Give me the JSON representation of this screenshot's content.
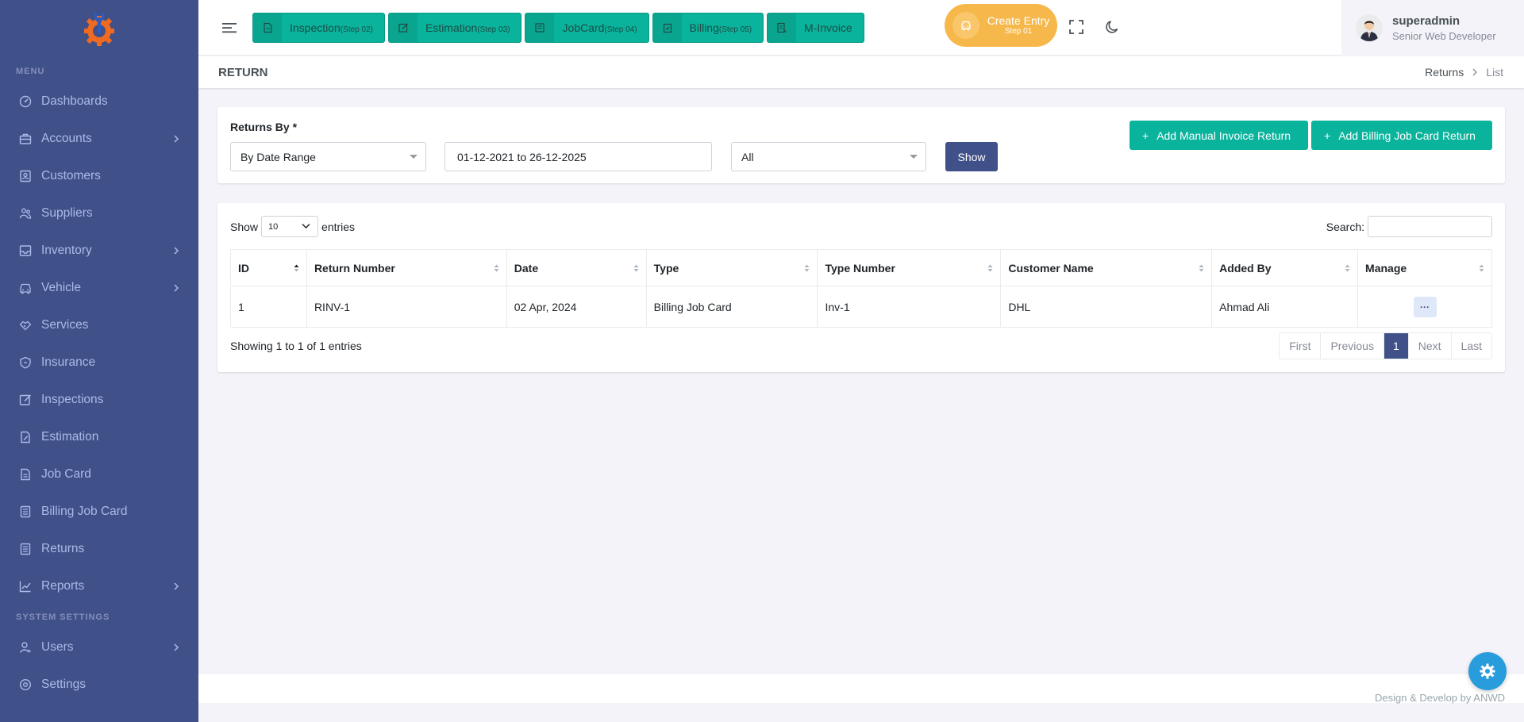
{
  "sidebar": {
    "menu_title": "MENU",
    "system_title": "SYSTEM SETTINGS",
    "items": [
      {
        "label": "Dashboards",
        "icon": "dashboard-icon",
        "has_children": false
      },
      {
        "label": "Accounts",
        "icon": "briefcase-icon",
        "has_children": true
      },
      {
        "label": "Customers",
        "icon": "contact-icon",
        "has_children": false
      },
      {
        "label": "Suppliers",
        "icon": "team-icon",
        "has_children": false
      },
      {
        "label": "Inventory",
        "icon": "inbox-icon",
        "has_children": true
      },
      {
        "label": "Vehicle",
        "icon": "car-icon",
        "has_children": true
      },
      {
        "label": "Services",
        "icon": "handshake-icon",
        "has_children": false
      },
      {
        "label": "Insurance",
        "icon": "shield-icon",
        "has_children": false
      },
      {
        "label": "Inspections",
        "icon": "edit-box-icon",
        "has_children": false
      },
      {
        "label": "Estimation",
        "icon": "file-edit-icon",
        "has_children": false
      },
      {
        "label": "Job Card",
        "icon": "file-icon",
        "has_children": false
      },
      {
        "label": "Billing Job Card",
        "icon": "list-file-icon",
        "has_children": false
      },
      {
        "label": "Returns",
        "icon": "list-file-icon",
        "has_children": false
      },
      {
        "label": "Reports",
        "icon": "line-chart-icon",
        "has_children": true
      }
    ],
    "system_items": [
      {
        "label": "Users",
        "icon": "user-icon",
        "has_children": true
      },
      {
        "label": "Settings",
        "icon": "settings-icon",
        "has_children": false
      }
    ]
  },
  "topbar": {
    "steps": [
      {
        "label": "Inspection",
        "step": "(Step 02)"
      },
      {
        "label": "Estimation",
        "step": "(Step 03)"
      },
      {
        "label": "JobCard",
        "step": "(Step 04)"
      },
      {
        "label": "Billing",
        "step": "(Step 05)"
      },
      {
        "label": "M-Invoice",
        "step": ""
      }
    ],
    "create_entry": {
      "title": "Create Entry",
      "step": "Step 01"
    },
    "user": {
      "name": "superadmin",
      "role": "Senior Web Developer"
    }
  },
  "page": {
    "title": "RETURN",
    "breadcrumb": {
      "parent": "Returns",
      "current": "List"
    }
  },
  "filter": {
    "label": "Returns By *",
    "returns_by": "By Date Range",
    "date_range": "01-12-2021 to 26-12-2025",
    "type": "All",
    "show_label": "Show",
    "add_manual": "Add Manual Invoice Return",
    "add_billing": "Add Billing Job Card Return"
  },
  "table": {
    "show_label": "Show",
    "page_length": "10",
    "entries_label": "entries",
    "search_label": "Search:",
    "search_value": "",
    "columns": [
      "ID",
      "Return Number",
      "Date",
      "Type",
      "Type Number",
      "Customer Name",
      "Added By",
      "Manage"
    ],
    "rows": [
      {
        "id": "1",
        "return_number": "RINV-1",
        "date": "02 Apr, 2024",
        "type": "Billing Job Card",
        "type_number": "Inv-1",
        "customer": "DHL",
        "added_by": "Ahmad Ali",
        "manage": "···"
      }
    ],
    "info": "Showing 1 to 1 of 1 entries",
    "pagination": {
      "first": "First",
      "previous": "Previous",
      "current": "1",
      "next": "Next",
      "last": "Last"
    }
  },
  "footer": {
    "text": "Design & Develop by ANWD"
  },
  "colors": {
    "sidebar": "#405189",
    "accent_green": "#0ab39c",
    "warning": "#f7b84b",
    "info": "#299cdb"
  }
}
